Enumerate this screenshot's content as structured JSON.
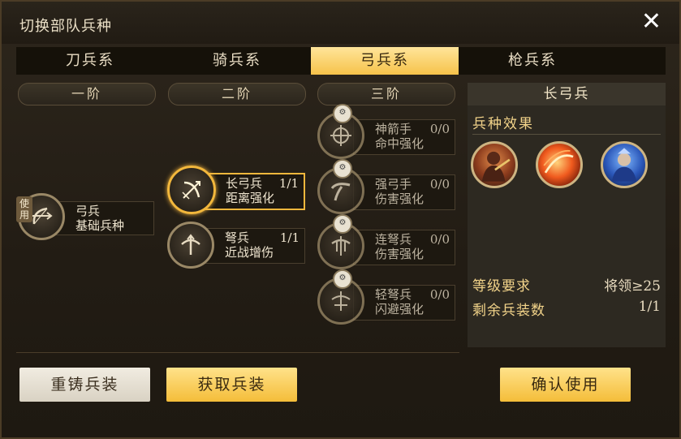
{
  "dialog": {
    "title": "切换部队兵种",
    "close_label": "✕"
  },
  "tabs": [
    {
      "label": "刀兵系",
      "active": false
    },
    {
      "label": "骑兵系",
      "active": false
    },
    {
      "label": "弓兵系",
      "active": true
    },
    {
      "label": "枪兵系",
      "active": false
    }
  ],
  "tiers": [
    "一阶",
    "二阶",
    "三阶"
  ],
  "units": {
    "archer": {
      "name": "弓兵",
      "desc": "基础兵种",
      "use_tag": "使用"
    },
    "longbow": {
      "name": "长弓兵",
      "count": "1/1",
      "desc": "距离强化"
    },
    "crossbow": {
      "name": "弩兵",
      "count": "1/1",
      "desc": "近战增伤"
    },
    "marksman": {
      "name": "神箭手",
      "count": "0/0",
      "desc": "命中强化"
    },
    "strongbow": {
      "name": "强弓手",
      "count": "0/0",
      "desc": "伤害强化"
    },
    "repeater": {
      "name": "连弩兵",
      "count": "0/0",
      "desc": "伤害强化"
    },
    "lightxbow": {
      "name": "轻弩兵",
      "count": "0/0",
      "desc": "闪避强化"
    }
  },
  "buttons": {
    "recast": "重铸兵装",
    "obtain": "获取兵装",
    "confirm": "确认使用"
  },
  "panel": {
    "title": "长弓兵",
    "effect_title": "兵种效果",
    "req_level_label": "等级要求",
    "req_level_value": "将领≥25",
    "remaining_label": "剩余兵装数",
    "remaining_value": "1/1"
  },
  "colors": {
    "accent_gold": "#f4bd39",
    "selected_border": "#f2b73c",
    "panel_bg": "#2d2921"
  }
}
